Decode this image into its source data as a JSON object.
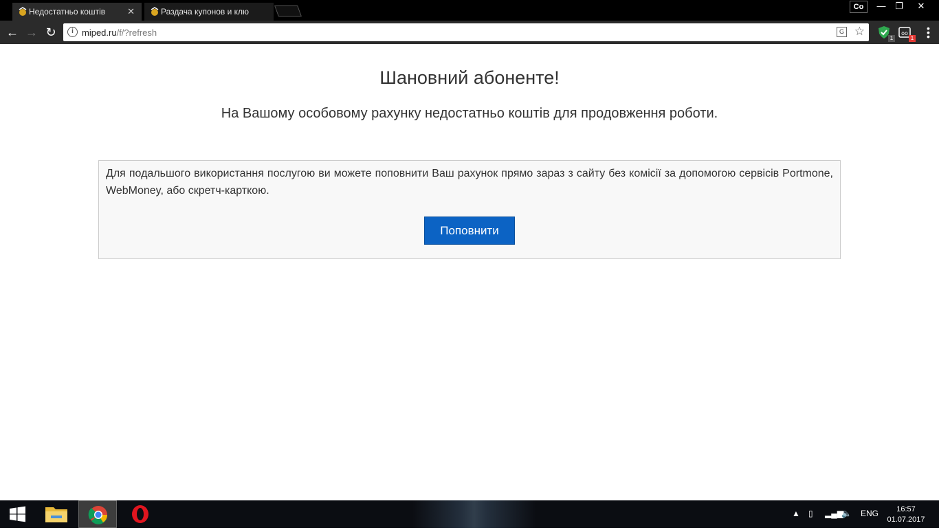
{
  "browser": {
    "tabs": [
      {
        "label": "Недостатньо коштів",
        "active": true
      },
      {
        "label": "Раздача купонов и клю",
        "active": false
      }
    ],
    "profile": "Co",
    "window_controls": {
      "minimize": "—",
      "restore": "❐",
      "close": "✕"
    },
    "url": {
      "host": "miped.ru",
      "path": "/f/?refresh"
    },
    "extensions": [
      {
        "icon": "shield-extension-icon",
        "badge": "1",
        "color": "#2fa84f"
      },
      {
        "icon": "dot-extension-icon",
        "badge": "1",
        "color": "#e53935"
      }
    ]
  },
  "page": {
    "heading": "Шановний абоненте!",
    "subheading": "На Вашому особовому рахунку недостатньо коштів для продовження роботи.",
    "info_text": "Для подальшого використання послугою ви можете поповнити Ваш рахунок прямо зараз з сайту без комісії за допомогою сервісів Portmone, WebMoney, або скретч-карткою.",
    "button_label": "Поповнити",
    "accent_color": "#0c63c4"
  },
  "taskbar": {
    "apps": [
      "file-explorer-icon",
      "chrome-icon",
      "opera-icon"
    ],
    "language": "ENG",
    "time": "16:57",
    "date": "01.07.2017"
  }
}
